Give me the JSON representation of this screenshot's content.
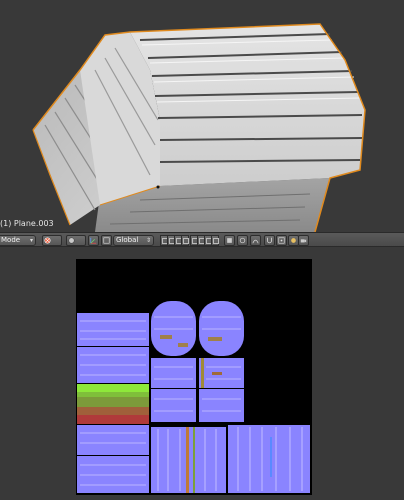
{
  "viewport": {
    "object_label": "(1) Plane.003"
  },
  "header": {
    "mode_label": "Mode",
    "orientation_label": "Global"
  },
  "colors": {
    "viewport_bg": "#393939",
    "selection_outline": "#e08a1e",
    "uv_bg": "#000000",
    "normal_map_base": "#8080ff"
  },
  "icons": [
    "pivot-icon",
    "snap-icon",
    "shading-icon",
    "manipulator-icon",
    "layer-grid-icon",
    "proportional-edit-icon",
    "render-preview-icon"
  ]
}
